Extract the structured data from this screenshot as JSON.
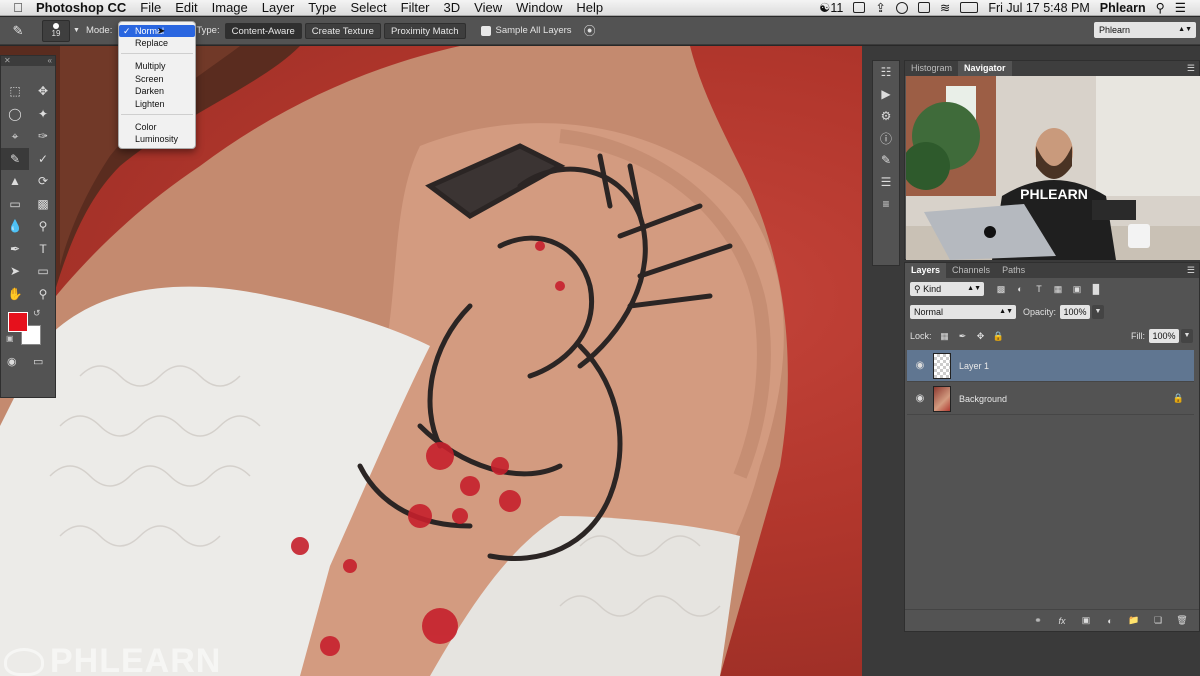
{
  "menubar": {
    "app": "Photoshop CC",
    "menus": [
      "File",
      "Edit",
      "Image",
      "Layer",
      "Type",
      "Select",
      "Filter",
      "3D",
      "View",
      "Window",
      "Help"
    ],
    "cc_count": "11",
    "datetime": "Fri Jul 17  5:48 PM",
    "user": "Phlearn"
  },
  "options": {
    "brush_size": "19",
    "mode_label": "Mode:",
    "mode_value": "Normal",
    "type_label": "Type:",
    "type_buttons": [
      "Content-Aware",
      "Create Texture",
      "Proximity Match"
    ],
    "sample_all": "Sample All Layers",
    "workspace": "Phlearn"
  },
  "mode_menu": {
    "items": [
      "Normal",
      "Replace",
      "Multiply",
      "Screen",
      "Darken",
      "Lighten",
      "Color",
      "Luminosity"
    ],
    "selected": "Normal"
  },
  "colors": {
    "foreground": "#e6111c",
    "background": "#ffffff",
    "selection": "#607691"
  },
  "navigator": {
    "tabs": [
      "Histogram",
      "Navigator"
    ],
    "active": "Navigator",
    "shirt_text": "PHLEARN"
  },
  "layers": {
    "tabs": [
      "Layers",
      "Channels",
      "Paths"
    ],
    "filter": "Kind",
    "blend": "Normal",
    "opacity_label": "Opacity:",
    "opacity": "100%",
    "lock_label": "Lock:",
    "fill_label": "Fill:",
    "fill": "100%",
    "items": [
      {
        "name": "Layer 1",
        "selected": true
      },
      {
        "name": "Background",
        "locked": true
      }
    ]
  },
  "watermark": "PHLEARN"
}
